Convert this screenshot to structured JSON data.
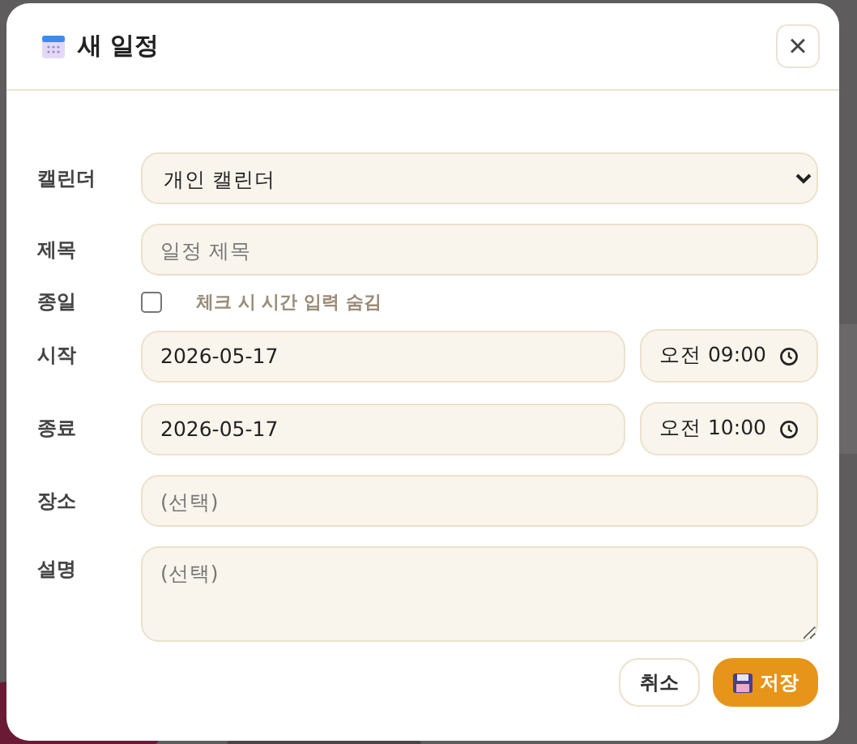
{
  "dialog": {
    "title": "새 일정",
    "close": "×"
  },
  "fields": [
    {
      "kind": "select",
      "label": "캘린더",
      "value": "개인 캘린더"
    },
    {
      "kind": "text",
      "label": "제목",
      "placeholder": "일정 제목"
    },
    {
      "kind": "checkbox",
      "label": "종일",
      "checked": false,
      "hint": "체크 시 시간 입력 숨김"
    },
    {
      "kind": "datetime",
      "label": "시작",
      "date": "2026-05-17",
      "time": "오전 09:00"
    },
    {
      "kind": "datetime",
      "label": "종료",
      "date": "2026-05-17",
      "time": "오전 10:00"
    },
    {
      "kind": "text",
      "label": "장소",
      "placeholder": "(선택)"
    },
    {
      "kind": "textarea",
      "label": "설명",
      "placeholder": "(선택)"
    }
  ],
  "buttons": [
    {
      "label": "취소",
      "kind": "secondary"
    },
    {
      "label": "저장",
      "kind": "primary"
    }
  ]
}
